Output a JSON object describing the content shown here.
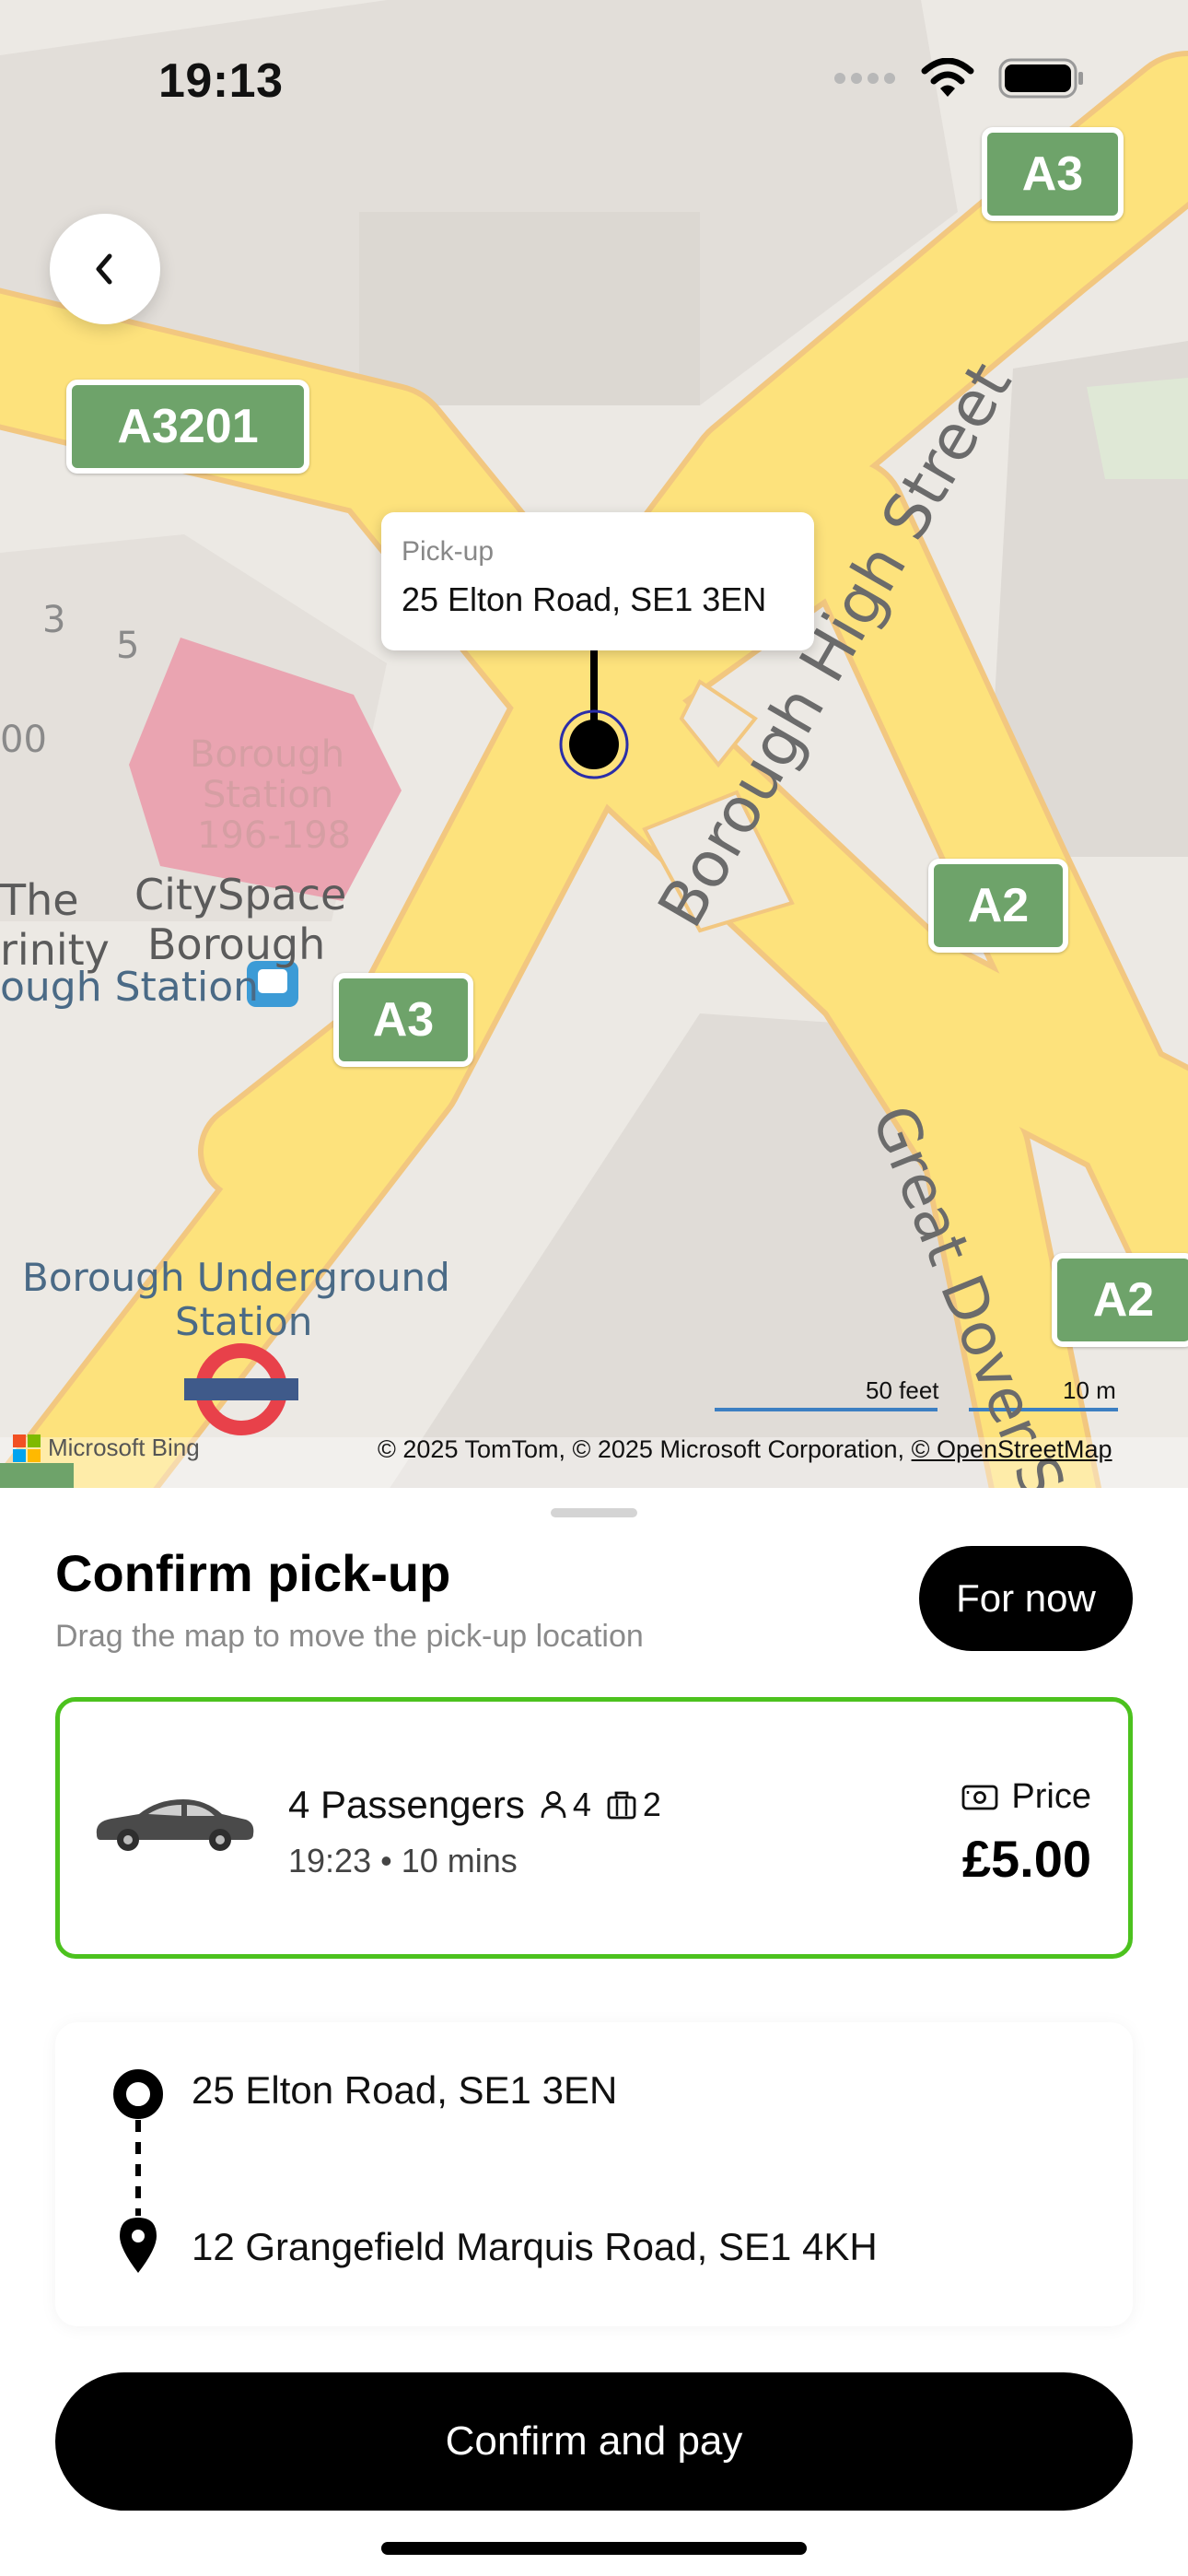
{
  "status_bar": {
    "time": "19:13"
  },
  "map": {
    "callout": {
      "label": "Pick-up",
      "address": "25 Elton Road, SE1 3EN"
    },
    "shields": [
      "A3",
      "A3201",
      "A2",
      "A3",
      "A2"
    ],
    "labels": {
      "borough_high_street": "Borough High Street",
      "great_dover": "Great Dover S",
      "borough_station_pink_1": "Borough",
      "borough_station_pink_2": "Station",
      "borough_station_pink_3": "196-198",
      "cityspace_1": "CitySpace",
      "cityspace_2": "Borough",
      "the": "The",
      "trinity": "rinity",
      "ough_station": "ough Station",
      "underground_1": "Borough Underground",
      "underground_2": "Station",
      "num_3": "3",
      "num_5": "5",
      "num_00": "00"
    },
    "scale": {
      "feet": "50 feet",
      "meters": "10 m"
    },
    "attribution_prefix": "© 2025 TomTom, © 2025 Microsoft Corporation, ",
    "attribution_link": "© OpenStreetMap",
    "bing": "Microsoft Bing"
  },
  "sheet": {
    "title": "Confirm pick-up",
    "subtitle": "Drag the map to move the pick-up location",
    "for_now": "For now",
    "ride": {
      "title": "4 Passengers",
      "passengers": "4",
      "luggage": "2",
      "subtitle": "19:23 • 10 mins",
      "price_label": "Price",
      "price_value": "£5.00"
    },
    "route": {
      "pickup": "25 Elton Road, SE1 3EN",
      "dropoff": "12 Grangefield Marquis Road, SE1 4KH"
    },
    "confirm_label": "Confirm and pay"
  },
  "colors": {
    "accent_green": "#4cc21e",
    "road_yellow": "#fde27c",
    "shield_green": "#6ea36a"
  }
}
